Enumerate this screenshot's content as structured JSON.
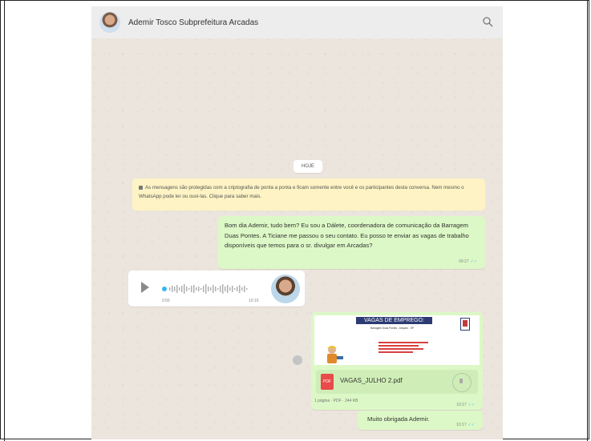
{
  "header": {
    "contact_name": "Ademir Tosco Subprefeitura Arcadas"
  },
  "date_label": "HOJE",
  "encryption_notice": "As mensagens são protegidas com a criptografia de ponta a ponta e ficam somente entre você e os participantes desta conversa. Nem mesmo o WhatsApp pode ler ou ouvi-las. Clique para saber mais.",
  "messages": [
    {
      "type": "text",
      "direction": "out",
      "text": "Bom dia Ademir, tudo bem? Eu sou a Dálete, coordenadora de comunicação da Barragem Duas Pontes. A Ticiane me passou o seu contato. Eu posso te enviar as vagas de trabalho disponíveis que temos para o sr. divulgar em Arcadas?",
      "time": "09:27"
    },
    {
      "type": "audio",
      "direction": "in",
      "duration": "0:56",
      "time": "10:15"
    },
    {
      "type": "document",
      "direction": "out",
      "thumb_title": "VAGAS DE EMPREGO:",
      "thumb_subtitle": "Barragem Duas Pontes - Amparo - SP",
      "file_name": "VAGAS_JULHO 2.pdf",
      "file_type": "PDF",
      "meta": "1 página · PDF · 244 KB",
      "time": "10:17"
    },
    {
      "type": "text",
      "direction": "out",
      "text": "Muito obrigada Ademir.",
      "time": "10:17"
    }
  ],
  "icons": [
    "search-icon",
    "play-icon",
    "forward-icon",
    "pdf-icon",
    "download-icon",
    "lock-icon"
  ],
  "colors": {
    "outgoing_bubble": "#dcf8c6",
    "incoming_bubble": "#ffffff",
    "chat_background": "#ece5dd",
    "notice_background": "#fdf3c4",
    "header_background": "#ededed",
    "read_tick": "#4fc3f7"
  }
}
